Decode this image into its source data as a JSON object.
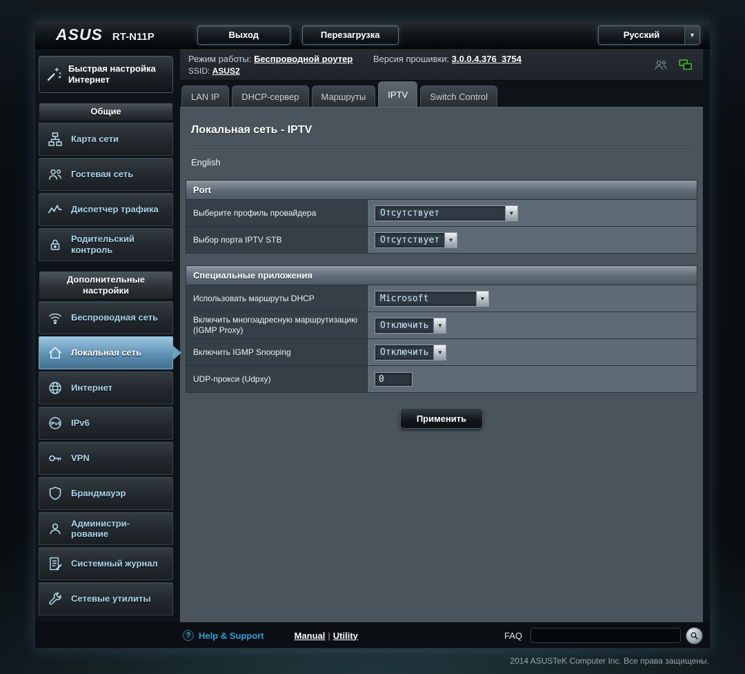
{
  "header": {
    "brand": "ASUS",
    "model": "RT-N11P",
    "logout_label": "Выход",
    "reboot_label": "Перезагрузка",
    "language_label": "Русский"
  },
  "infobar": {
    "mode_label": "Режим работы:",
    "mode_value": "Беспроводной роутер",
    "firmware_label": "Версия прошивки:",
    "firmware_value": "3.0.0.4.376_3754",
    "ssid_label": "SSID:",
    "ssid_value": "ASUS2"
  },
  "tabs": [
    {
      "label": "LAN IP"
    },
    {
      "label": "DHCP-сервер"
    },
    {
      "label": "Маршруты"
    },
    {
      "label": "IPTV"
    },
    {
      "label": "Switch Control"
    }
  ],
  "sidebar": {
    "quick_setup_label": "Быстрая настройка Интернет",
    "section_general": "Общие",
    "section_advanced": "Дополнительные настройки",
    "items": [
      {
        "label": "Карта сети",
        "icon": "network-map"
      },
      {
        "label": "Гостевая сеть",
        "icon": "guest-network"
      },
      {
        "label": "Диспетчер трафика",
        "icon": "traffic-manager"
      },
      {
        "label": "Родительский контроль",
        "icon": "parental-control"
      },
      {
        "label": "Беспроводная сеть",
        "icon": "wireless"
      },
      {
        "label": "Локальная сеть",
        "icon": "lan"
      },
      {
        "label": "Интернет",
        "icon": "internet"
      },
      {
        "label": "IPv6",
        "icon": "ipv6"
      },
      {
        "label": "VPN",
        "icon": "vpn"
      },
      {
        "label": "Брандмауэр",
        "icon": "firewall"
      },
      {
        "label": "Администри-рование",
        "icon": "administration"
      },
      {
        "label": "Системный журнал",
        "icon": "system-log"
      },
      {
        "label": "Сетевые утилиты",
        "icon": "network-tools"
      }
    ]
  },
  "main": {
    "title": "Локальная сеть - IPTV",
    "language_link": "English",
    "apply_label": "Применить",
    "sections": [
      {
        "title": "Port",
        "rows": [
          {
            "label": "Выберите профиль провайдера",
            "value": "Отсутствует"
          },
          {
            "label": "Выбор порта IPTV STB",
            "value": "Отсутствует"
          }
        ]
      },
      {
        "title": "Специальные приложения",
        "rows": [
          {
            "label": "Использовать маршруты DHCP",
            "value": "Microsoft"
          },
          {
            "label": "Включить многоадресную маршрутизацию (IGMP Proxy)",
            "value": "Отключить"
          },
          {
            "label": "Включить IGMP Snooping",
            "value": "Отключить"
          },
          {
            "label": "UDP-прокси (Udpxy)",
            "value": "0"
          }
        ]
      }
    ]
  },
  "footer": {
    "help_label": "Help & Support",
    "manual_label": "Manual",
    "separator": "|",
    "utility_label": "Utility",
    "faq_label": "FAQ",
    "search_value": ""
  },
  "copyright": "2014  ASUSTeK Computer Inc. Все права защищены."
}
